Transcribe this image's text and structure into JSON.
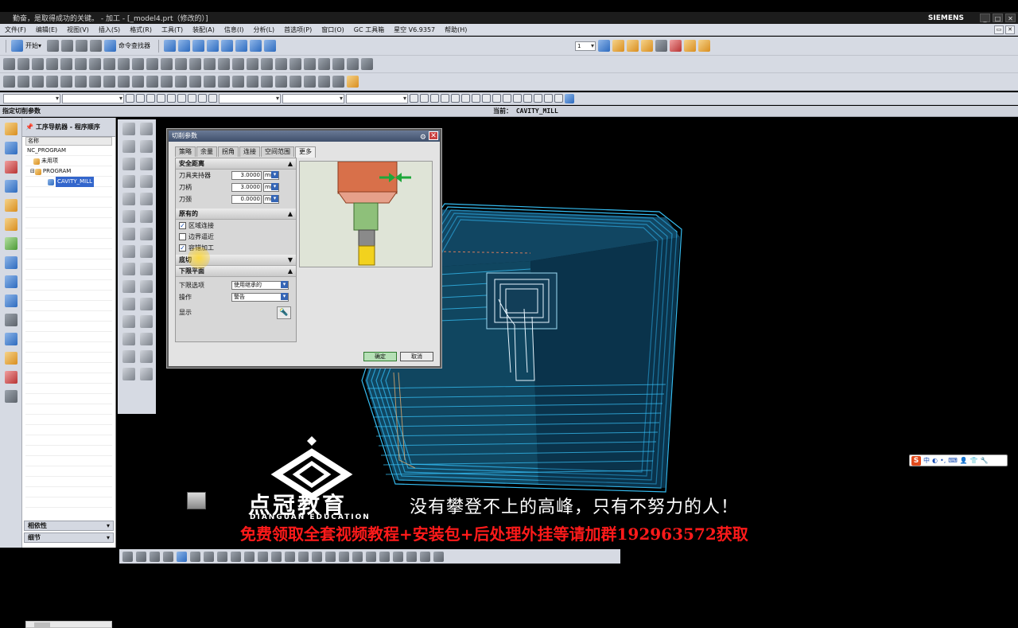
{
  "window": {
    "title": "勤奋，是取得成功的关键。 - 加工 - [_model4.prt（修改的）]",
    "brand": "SIEMENS"
  },
  "menu": [
    "文件(F)",
    "编辑(E)",
    "视图(V)",
    "插入(S)",
    "格式(R)",
    "工具(T)",
    "装配(A)",
    "信息(I)",
    "分析(L)",
    "首选项(P)",
    "窗口(O)",
    "GC 工具箱",
    "星空 V6.9357",
    "帮助(H)"
  ],
  "toolbar": {
    "start_label": "开始▾",
    "cmd_finder_label": "命令查找器",
    "layer_value": "1"
  },
  "cue": {
    "left": "指定切削参数",
    "right": "当前： CAVITY_MILL"
  },
  "navigator": {
    "title": "工序导航器 - 程序顺序",
    "column": "名称",
    "rows": [
      "NC_PROGRAM",
      "未用项",
      "PROGRAM",
      "CAVITY_MILL"
    ],
    "acc1": "相依性",
    "acc2": "细节"
  },
  "dialog": {
    "title": "切削参数",
    "tabs": [
      "策略",
      "余量",
      "拐角",
      "连接",
      "空间范围",
      "更多"
    ],
    "active_tab": "更多",
    "safe_section": "安全距离",
    "fields": [
      {
        "label": "刀具夹持器",
        "value": "3.0000",
        "unit": "mm"
      },
      {
        "label": "刀柄",
        "value": "3.0000",
        "unit": "mm"
      },
      {
        "label": "刀颈",
        "value": "0.0000",
        "unit": "mm"
      }
    ],
    "orig_section": "原有的",
    "checks": [
      {
        "label": "区域连接",
        "checked": true
      },
      {
        "label": "边界逼近",
        "checked": false
      },
      {
        "label": "容错加工",
        "checked": true
      }
    ],
    "undercut_section": "底切",
    "lower_section": "下限平面",
    "lower_option_label": "下限选项",
    "lower_option_value": "使用继承的",
    "operation_label": "操作",
    "operation_value": "警告",
    "display_label": "显示",
    "ok": "确定",
    "cancel": "取消"
  },
  "ime": {
    "label": "中"
  },
  "watermark": {
    "brand_cn": "点冠教育",
    "brand_en": "DIANGUAN EDUCATION",
    "slogan": "没有攀登不上的高峰，只有不努力的人！",
    "promo": "免费领取全套视频教程+安装包+后处理外挂等请加群192963572获取"
  },
  "colors": {
    "toolpath": "#39c8ff",
    "promo": "#ff1a1a",
    "ok_button": "#b6e0b6"
  }
}
